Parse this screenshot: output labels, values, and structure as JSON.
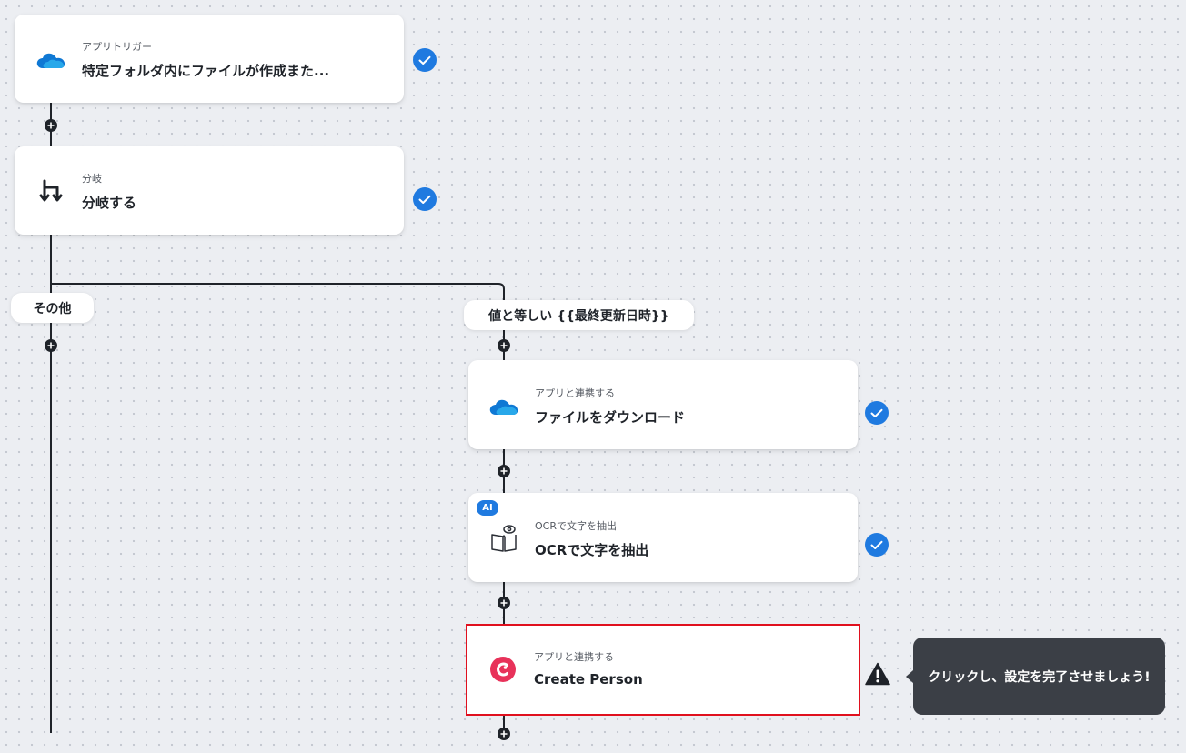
{
  "steps": {
    "trigger": {
      "sub": "アプリトリガー",
      "title": "特定フォルダ内にファイルが作成また...",
      "icon": "onedrive-cloud-icon"
    },
    "branch": {
      "sub": "分岐",
      "title": "分岐する",
      "icon": "branch-icon"
    },
    "download": {
      "sub": "アプリと連携する",
      "title": "ファイルをダウンロード",
      "icon": "onedrive-cloud-icon"
    },
    "ocr": {
      "sub": "OCRで文字を抽出",
      "title": "OCRで文字を抽出",
      "badge": "AI",
      "icon": "ocr-book-eye-icon"
    },
    "create_person": {
      "sub": "アプリと連携する",
      "title": "Create Person",
      "icon": "capsule-crm-logo-icon"
    }
  },
  "branches": {
    "other": "その他",
    "equals": "値と等しい {{最終更新日時}}"
  },
  "tooltip": "クリックし、設定を完了させましょう!",
  "colors": {
    "accent_blue": "#1f7ae0",
    "error_red": "#e0101e",
    "line_dark": "#1f2329",
    "onedrive_blue": "#0f78d4",
    "capsule_pink": "#e8325a",
    "tooltip_bg": "#3b3f46"
  }
}
